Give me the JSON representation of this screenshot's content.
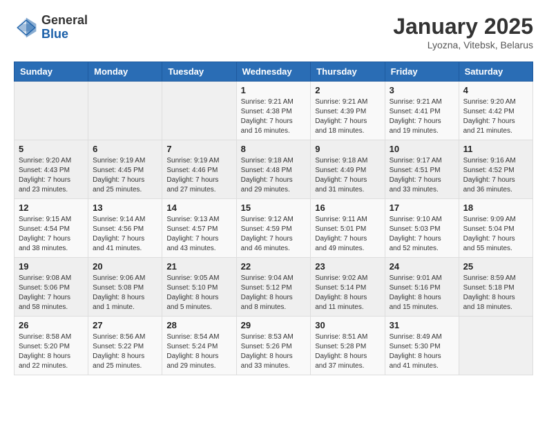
{
  "header": {
    "logo_general": "General",
    "logo_blue": "Blue",
    "month_year": "January 2025",
    "location": "Lyozna, Vitebsk, Belarus"
  },
  "days_of_week": [
    "Sunday",
    "Monday",
    "Tuesday",
    "Wednesday",
    "Thursday",
    "Friday",
    "Saturday"
  ],
  "weeks": [
    [
      {
        "day": "",
        "content": ""
      },
      {
        "day": "",
        "content": ""
      },
      {
        "day": "",
        "content": ""
      },
      {
        "day": "1",
        "content": "Sunrise: 9:21 AM\nSunset: 4:38 PM\nDaylight: 7 hours\nand 16 minutes."
      },
      {
        "day": "2",
        "content": "Sunrise: 9:21 AM\nSunset: 4:39 PM\nDaylight: 7 hours\nand 18 minutes."
      },
      {
        "day": "3",
        "content": "Sunrise: 9:21 AM\nSunset: 4:41 PM\nDaylight: 7 hours\nand 19 minutes."
      },
      {
        "day": "4",
        "content": "Sunrise: 9:20 AM\nSunset: 4:42 PM\nDaylight: 7 hours\nand 21 minutes."
      }
    ],
    [
      {
        "day": "5",
        "content": "Sunrise: 9:20 AM\nSunset: 4:43 PM\nDaylight: 7 hours\nand 23 minutes."
      },
      {
        "day": "6",
        "content": "Sunrise: 9:19 AM\nSunset: 4:45 PM\nDaylight: 7 hours\nand 25 minutes."
      },
      {
        "day": "7",
        "content": "Sunrise: 9:19 AM\nSunset: 4:46 PM\nDaylight: 7 hours\nand 27 minutes."
      },
      {
        "day": "8",
        "content": "Sunrise: 9:18 AM\nSunset: 4:48 PM\nDaylight: 7 hours\nand 29 minutes."
      },
      {
        "day": "9",
        "content": "Sunrise: 9:18 AM\nSunset: 4:49 PM\nDaylight: 7 hours\nand 31 minutes."
      },
      {
        "day": "10",
        "content": "Sunrise: 9:17 AM\nSunset: 4:51 PM\nDaylight: 7 hours\nand 33 minutes."
      },
      {
        "day": "11",
        "content": "Sunrise: 9:16 AM\nSunset: 4:52 PM\nDaylight: 7 hours\nand 36 minutes."
      }
    ],
    [
      {
        "day": "12",
        "content": "Sunrise: 9:15 AM\nSunset: 4:54 PM\nDaylight: 7 hours\nand 38 minutes."
      },
      {
        "day": "13",
        "content": "Sunrise: 9:14 AM\nSunset: 4:56 PM\nDaylight: 7 hours\nand 41 minutes."
      },
      {
        "day": "14",
        "content": "Sunrise: 9:13 AM\nSunset: 4:57 PM\nDaylight: 7 hours\nand 43 minutes."
      },
      {
        "day": "15",
        "content": "Sunrise: 9:12 AM\nSunset: 4:59 PM\nDaylight: 7 hours\nand 46 minutes."
      },
      {
        "day": "16",
        "content": "Sunrise: 9:11 AM\nSunset: 5:01 PM\nDaylight: 7 hours\nand 49 minutes."
      },
      {
        "day": "17",
        "content": "Sunrise: 9:10 AM\nSunset: 5:03 PM\nDaylight: 7 hours\nand 52 minutes."
      },
      {
        "day": "18",
        "content": "Sunrise: 9:09 AM\nSunset: 5:04 PM\nDaylight: 7 hours\nand 55 minutes."
      }
    ],
    [
      {
        "day": "19",
        "content": "Sunrise: 9:08 AM\nSunset: 5:06 PM\nDaylight: 7 hours\nand 58 minutes."
      },
      {
        "day": "20",
        "content": "Sunrise: 9:06 AM\nSunset: 5:08 PM\nDaylight: 8 hours\nand 1 minute."
      },
      {
        "day": "21",
        "content": "Sunrise: 9:05 AM\nSunset: 5:10 PM\nDaylight: 8 hours\nand 5 minutes."
      },
      {
        "day": "22",
        "content": "Sunrise: 9:04 AM\nSunset: 5:12 PM\nDaylight: 8 hours\nand 8 minutes."
      },
      {
        "day": "23",
        "content": "Sunrise: 9:02 AM\nSunset: 5:14 PM\nDaylight: 8 hours\nand 11 minutes."
      },
      {
        "day": "24",
        "content": "Sunrise: 9:01 AM\nSunset: 5:16 PM\nDaylight: 8 hours\nand 15 minutes."
      },
      {
        "day": "25",
        "content": "Sunrise: 8:59 AM\nSunset: 5:18 PM\nDaylight: 8 hours\nand 18 minutes."
      }
    ],
    [
      {
        "day": "26",
        "content": "Sunrise: 8:58 AM\nSunset: 5:20 PM\nDaylight: 8 hours\nand 22 minutes."
      },
      {
        "day": "27",
        "content": "Sunrise: 8:56 AM\nSunset: 5:22 PM\nDaylight: 8 hours\nand 25 minutes."
      },
      {
        "day": "28",
        "content": "Sunrise: 8:54 AM\nSunset: 5:24 PM\nDaylight: 8 hours\nand 29 minutes."
      },
      {
        "day": "29",
        "content": "Sunrise: 8:53 AM\nSunset: 5:26 PM\nDaylight: 8 hours\nand 33 minutes."
      },
      {
        "day": "30",
        "content": "Sunrise: 8:51 AM\nSunset: 5:28 PM\nDaylight: 8 hours\nand 37 minutes."
      },
      {
        "day": "31",
        "content": "Sunrise: 8:49 AM\nSunset: 5:30 PM\nDaylight: 8 hours\nand 41 minutes."
      },
      {
        "day": "",
        "content": ""
      }
    ]
  ]
}
